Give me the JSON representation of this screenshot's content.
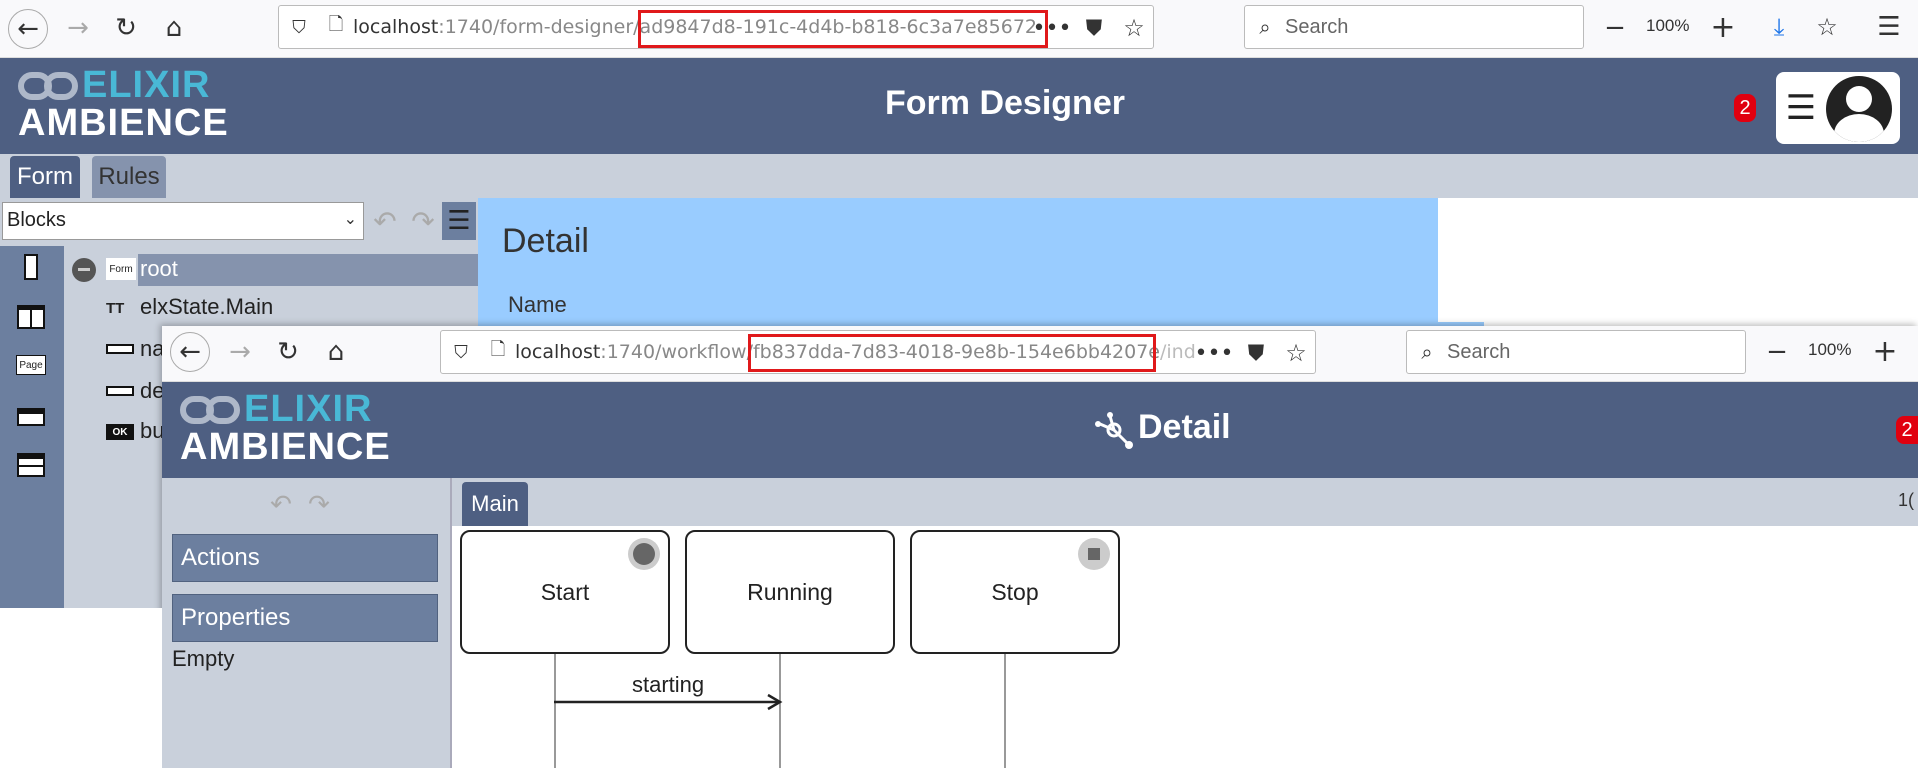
{
  "back_window": {
    "browser": {
      "url_host": "localhost",
      "url_rest": ":1740/form-designer/",
      "url_id": "ad9847d8-191c-4d4b-b818-6c3a7e85672",
      "search_placeholder": "Search",
      "zoom": "100%"
    },
    "header": {
      "logo_top": "ELIXIR",
      "logo_bottom": "AMBIENCE",
      "title": "Form Designer",
      "notification_count": "2"
    },
    "tabs": [
      "Form",
      "Rules"
    ],
    "blocks_select": "Blocks",
    "tree": {
      "root_tag": "Form",
      "root_label": "root",
      "items": [
        {
          "icon": "TT",
          "label": "elxState.Main"
        },
        {
          "icon": "",
          "label": "na"
        },
        {
          "icon": "",
          "label": "de"
        },
        {
          "icon": "OK",
          "label": "bu"
        }
      ]
    },
    "palette_page_label": "Page",
    "detail": {
      "title": "Detail",
      "field_label": "Name"
    }
  },
  "front_window": {
    "browser": {
      "url_host": "localhost",
      "url_rest": ":1740/workflow/",
      "url_id": "fb837dda-7d83-4018-9e8b-154e6bb4207e",
      "url_tail": "/ind",
      "search_placeholder": "Search",
      "zoom": "100%"
    },
    "header": {
      "logo_top": "ELIXIR",
      "logo_bottom": "AMBIENCE",
      "title": "Detail",
      "notification_count": "2"
    },
    "tab_main": "Main",
    "tab_right_fragment": "1(",
    "sidebar": {
      "actions_label": "Actions",
      "properties_label": "Properties",
      "properties_value": "Empty"
    },
    "diagram": {
      "states": [
        {
          "label": "Start",
          "marker": "circle"
        },
        {
          "label": "Running",
          "marker": "none"
        },
        {
          "label": "Stop",
          "marker": "square"
        }
      ],
      "transitions": [
        {
          "from": "Start",
          "to": "Running",
          "label": "starting"
        }
      ]
    }
  },
  "colors": {
    "header_bg": "#4e5f82",
    "accent_logo": "#49b8d6",
    "tab_active": "#4e5f82",
    "highlight_box": "#e0191b",
    "detail_panel": "#99ccff",
    "badge": "#e0000f"
  }
}
